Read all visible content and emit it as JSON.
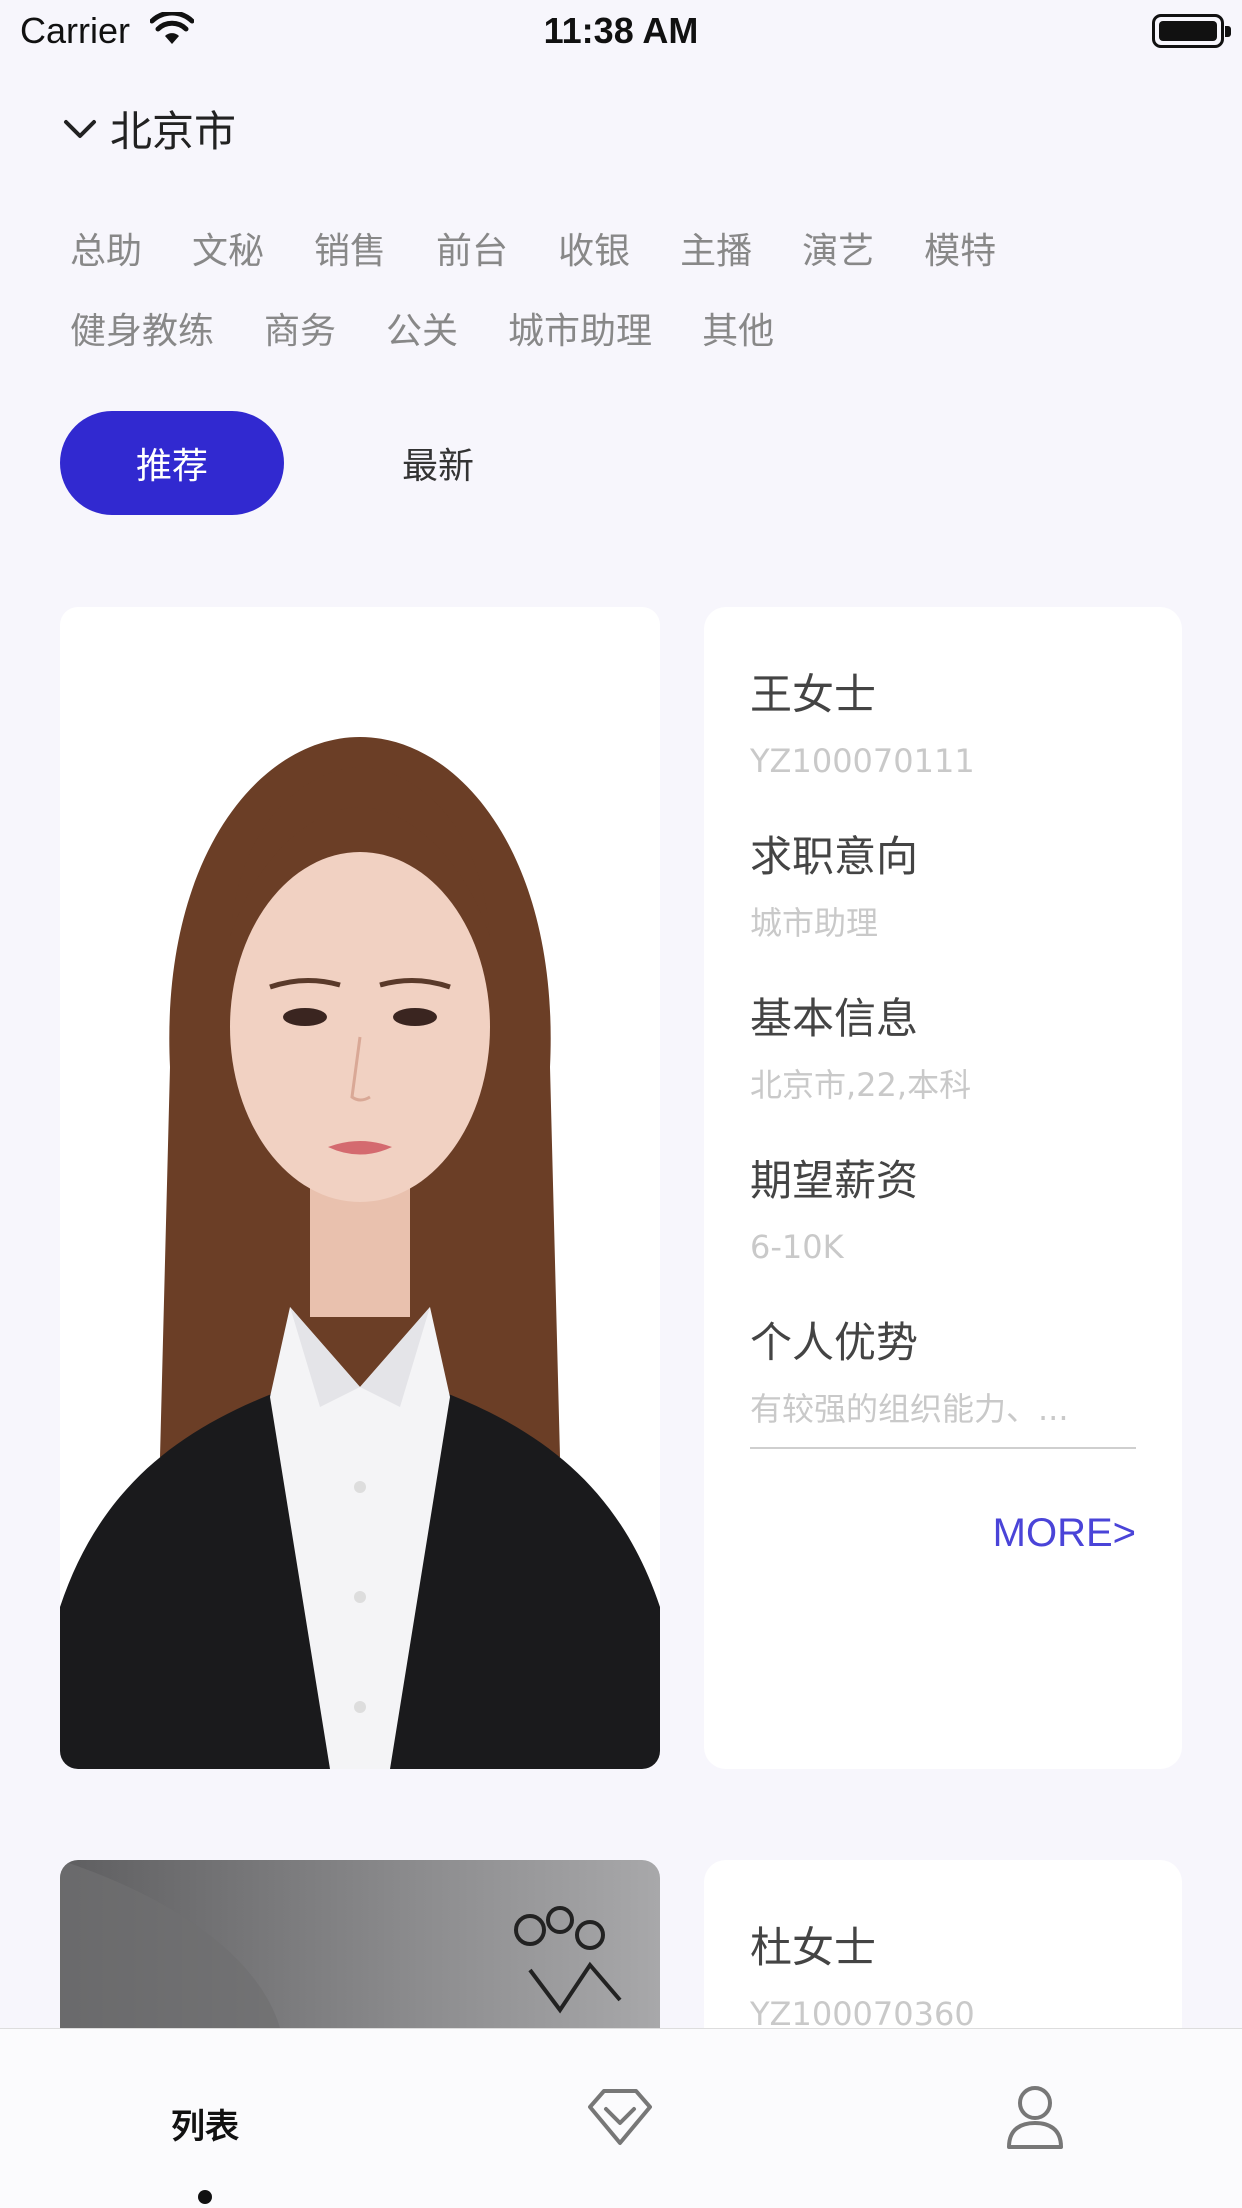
{
  "status_bar": {
    "carrier": "Carrier",
    "time": "11:38 AM"
  },
  "location": {
    "city": "北京市"
  },
  "categories": {
    "row1": [
      "总助",
      "文秘",
      "销售",
      "前台",
      "收银",
      "主播",
      "演艺",
      "模特"
    ],
    "row2": [
      "健身教练",
      "商务",
      "公关",
      "城市助理",
      "其他"
    ]
  },
  "sort_tabs": {
    "active": "推荐",
    "inactive": "最新"
  },
  "candidates": [
    {
      "name": "王女士",
      "id": "YZ100070111",
      "fields": [
        {
          "label": "求职意向",
          "value": "城市助理"
        },
        {
          "label": "基本信息",
          "value": "北京市,22,本科"
        },
        {
          "label": "期望薪资",
          "value": "6-10K"
        },
        {
          "label": "个人优势",
          "value": "有较强的组织能力、..."
        }
      ],
      "more": "MORE>"
    },
    {
      "name": "杜女士",
      "id": "YZ100070360"
    }
  ],
  "tab_bar": {
    "list_label": "列表",
    "icons": [
      "diamond-icon",
      "profile-icon"
    ]
  }
}
